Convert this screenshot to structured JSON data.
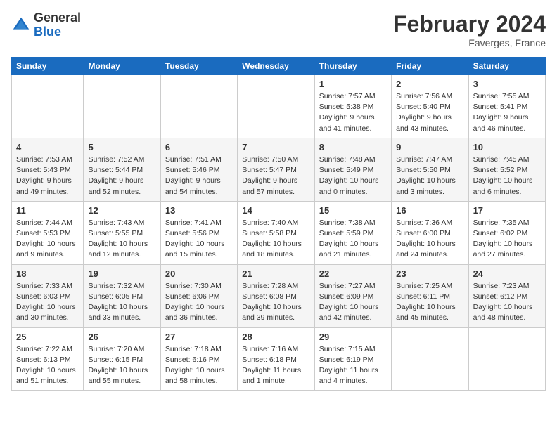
{
  "header": {
    "logo_general": "General",
    "logo_blue": "Blue",
    "month_title": "February 2024",
    "location": "Faverges, France"
  },
  "days_of_week": [
    "Sunday",
    "Monday",
    "Tuesday",
    "Wednesday",
    "Thursday",
    "Friday",
    "Saturday"
  ],
  "weeks": [
    [
      {
        "num": "",
        "info": ""
      },
      {
        "num": "",
        "info": ""
      },
      {
        "num": "",
        "info": ""
      },
      {
        "num": "",
        "info": ""
      },
      {
        "num": "1",
        "info": "Sunrise: 7:57 AM\nSunset: 5:38 PM\nDaylight: 9 hours\nand 41 minutes."
      },
      {
        "num": "2",
        "info": "Sunrise: 7:56 AM\nSunset: 5:40 PM\nDaylight: 9 hours\nand 43 minutes."
      },
      {
        "num": "3",
        "info": "Sunrise: 7:55 AM\nSunset: 5:41 PM\nDaylight: 9 hours\nand 46 minutes."
      }
    ],
    [
      {
        "num": "4",
        "info": "Sunrise: 7:53 AM\nSunset: 5:43 PM\nDaylight: 9 hours\nand 49 minutes."
      },
      {
        "num": "5",
        "info": "Sunrise: 7:52 AM\nSunset: 5:44 PM\nDaylight: 9 hours\nand 52 minutes."
      },
      {
        "num": "6",
        "info": "Sunrise: 7:51 AM\nSunset: 5:46 PM\nDaylight: 9 hours\nand 54 minutes."
      },
      {
        "num": "7",
        "info": "Sunrise: 7:50 AM\nSunset: 5:47 PM\nDaylight: 9 hours\nand 57 minutes."
      },
      {
        "num": "8",
        "info": "Sunrise: 7:48 AM\nSunset: 5:49 PM\nDaylight: 10 hours\nand 0 minutes."
      },
      {
        "num": "9",
        "info": "Sunrise: 7:47 AM\nSunset: 5:50 PM\nDaylight: 10 hours\nand 3 minutes."
      },
      {
        "num": "10",
        "info": "Sunrise: 7:45 AM\nSunset: 5:52 PM\nDaylight: 10 hours\nand 6 minutes."
      }
    ],
    [
      {
        "num": "11",
        "info": "Sunrise: 7:44 AM\nSunset: 5:53 PM\nDaylight: 10 hours\nand 9 minutes."
      },
      {
        "num": "12",
        "info": "Sunrise: 7:43 AM\nSunset: 5:55 PM\nDaylight: 10 hours\nand 12 minutes."
      },
      {
        "num": "13",
        "info": "Sunrise: 7:41 AM\nSunset: 5:56 PM\nDaylight: 10 hours\nand 15 minutes."
      },
      {
        "num": "14",
        "info": "Sunrise: 7:40 AM\nSunset: 5:58 PM\nDaylight: 10 hours\nand 18 minutes."
      },
      {
        "num": "15",
        "info": "Sunrise: 7:38 AM\nSunset: 5:59 PM\nDaylight: 10 hours\nand 21 minutes."
      },
      {
        "num": "16",
        "info": "Sunrise: 7:36 AM\nSunset: 6:00 PM\nDaylight: 10 hours\nand 24 minutes."
      },
      {
        "num": "17",
        "info": "Sunrise: 7:35 AM\nSunset: 6:02 PM\nDaylight: 10 hours\nand 27 minutes."
      }
    ],
    [
      {
        "num": "18",
        "info": "Sunrise: 7:33 AM\nSunset: 6:03 PM\nDaylight: 10 hours\nand 30 minutes."
      },
      {
        "num": "19",
        "info": "Sunrise: 7:32 AM\nSunset: 6:05 PM\nDaylight: 10 hours\nand 33 minutes."
      },
      {
        "num": "20",
        "info": "Sunrise: 7:30 AM\nSunset: 6:06 PM\nDaylight: 10 hours\nand 36 minutes."
      },
      {
        "num": "21",
        "info": "Sunrise: 7:28 AM\nSunset: 6:08 PM\nDaylight: 10 hours\nand 39 minutes."
      },
      {
        "num": "22",
        "info": "Sunrise: 7:27 AM\nSunset: 6:09 PM\nDaylight: 10 hours\nand 42 minutes."
      },
      {
        "num": "23",
        "info": "Sunrise: 7:25 AM\nSunset: 6:11 PM\nDaylight: 10 hours\nand 45 minutes."
      },
      {
        "num": "24",
        "info": "Sunrise: 7:23 AM\nSunset: 6:12 PM\nDaylight: 10 hours\nand 48 minutes."
      }
    ],
    [
      {
        "num": "25",
        "info": "Sunrise: 7:22 AM\nSunset: 6:13 PM\nDaylight: 10 hours\nand 51 minutes."
      },
      {
        "num": "26",
        "info": "Sunrise: 7:20 AM\nSunset: 6:15 PM\nDaylight: 10 hours\nand 55 minutes."
      },
      {
        "num": "27",
        "info": "Sunrise: 7:18 AM\nSunset: 6:16 PM\nDaylight: 10 hours\nand 58 minutes."
      },
      {
        "num": "28",
        "info": "Sunrise: 7:16 AM\nSunset: 6:18 PM\nDaylight: 11 hours\nand 1 minute."
      },
      {
        "num": "29",
        "info": "Sunrise: 7:15 AM\nSunset: 6:19 PM\nDaylight: 11 hours\nand 4 minutes."
      },
      {
        "num": "",
        "info": ""
      },
      {
        "num": "",
        "info": ""
      }
    ]
  ]
}
